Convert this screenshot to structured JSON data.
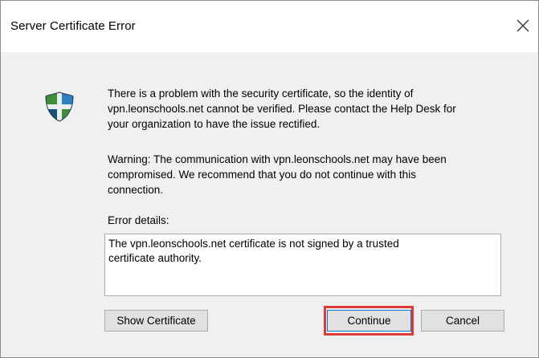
{
  "window": {
    "title": "Server Certificate Error"
  },
  "message": {
    "line1": "There is a problem with the security certificate, so the identity of",
    "line2": "vpn.leonschools.net cannot be verified. Please contact the Help Desk for",
    "line3": "your organization to have the issue rectified."
  },
  "warning": {
    "line1": "Warning: The communication with vpn.leonschools.net may have been",
    "line2": "compromised. We recommend that you do not continue with this",
    "line3": "connection."
  },
  "details": {
    "label": "Error details:",
    "text": "The vpn.leonschools.net certificate is not signed by a trusted\ncertificate authority."
  },
  "buttons": {
    "show_certificate": "Show Certificate",
    "continue": "Continue",
    "cancel": "Cancel"
  },
  "icons": {
    "close": "close-icon",
    "shield": "security-shield-icon"
  },
  "colors": {
    "highlight": "#e03b3b",
    "shield_blue": "#1f5f93",
    "shield_green": "#3f8f3a"
  }
}
